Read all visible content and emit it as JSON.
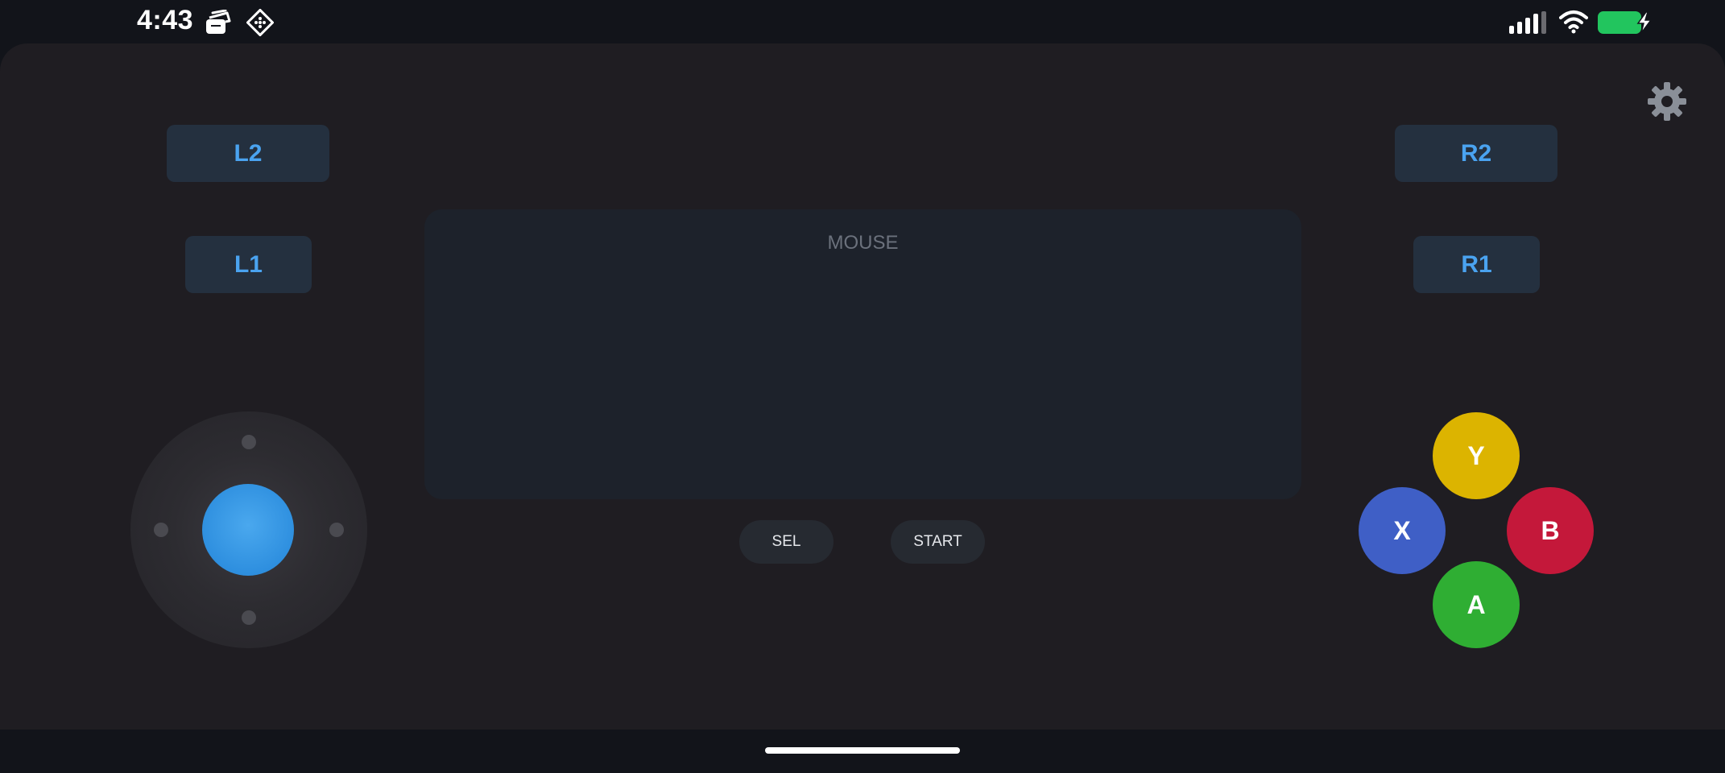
{
  "status_bar": {
    "time": "4:43",
    "icons": [
      "notes-stack-icon",
      "diamond-grid-icon",
      "cellular-signal-icon",
      "wifi-icon",
      "battery-charging-icon"
    ],
    "battery_color": "#22c55e"
  },
  "controller": {
    "shoulders": {
      "l2": "L2",
      "l1": "L1",
      "r2": "R2",
      "r1": "R1"
    },
    "mouse_pad_label": "MOUSE",
    "select_label": "SEL",
    "start_label": "START",
    "face_buttons": {
      "y": {
        "label": "Y",
        "color": "#dcb400"
      },
      "x": {
        "label": "X",
        "color": "#3f5fc6"
      },
      "b": {
        "label": "B",
        "color": "#c4183a"
      },
      "a": {
        "label": "A",
        "color": "#2fae33"
      }
    },
    "settings_icon": "gear-icon",
    "accent_color": "#4aa3f0"
  }
}
